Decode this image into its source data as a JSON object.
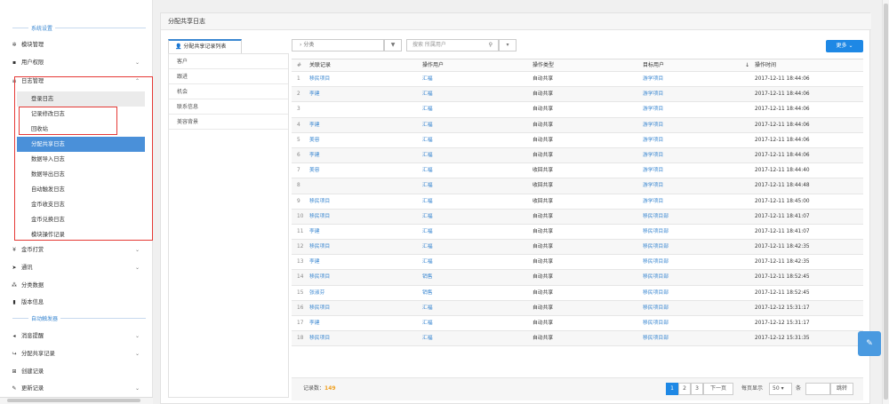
{
  "sidebar": {
    "sections": {
      "system": "系统设置",
      "auto": "自动触发器"
    },
    "items": {
      "module_mgmt": "模块管理",
      "user_perm": "用户权限",
      "log_mgmt": "日志管理",
      "coin_reward": "金币打赏",
      "comm": "通讯",
      "category": "分类数据",
      "version": "版本信息",
      "msg_remind": "消息提醒",
      "share_record": "分配共享记录",
      "create_record": "创建记录",
      "update_record": "更新记录"
    },
    "log_children": [
      "登录日志",
      "记录修改日志",
      "回收站",
      "分配共享日志",
      "数据导入日志",
      "数据导出日志",
      "自动触发日志",
      "金币收支日志",
      "金币兑换日志",
      "模块操作记录"
    ]
  },
  "main": {
    "title": "分配共享日志",
    "left_tab": "分配共享记录列表",
    "left_list": [
      "客户",
      "跟进",
      "机会",
      "联系信息",
      "美容背景"
    ],
    "filter_label": "分类",
    "filter_search_placeholder": "搜索 所属用户",
    "more_button": "更多",
    "columns": [
      "#",
      "关联记录",
      "操作用户",
      "操作类型",
      "目标用户",
      "操作时间"
    ],
    "rows": [
      {
        "n": "1",
        "rec": "移民项目",
        "user": "汇福",
        "type": "自动共享",
        "target": "游学项目",
        "time": "2017-12-11 18:44:06"
      },
      {
        "n": "2",
        "rec": "李建",
        "user": "汇福",
        "type": "自动共享",
        "target": "游学项目",
        "time": "2017-12-11 18:44:06"
      },
      {
        "n": "3",
        "rec": "",
        "user": "汇福",
        "type": "自动共享",
        "target": "游学项目",
        "time": "2017-12-11 18:44:06"
      },
      {
        "n": "4",
        "rec": "李建",
        "user": "汇福",
        "type": "自动共享",
        "target": "游学项目",
        "time": "2017-12-11 18:44:06"
      },
      {
        "n": "5",
        "rec": "美容",
        "user": "汇福",
        "type": "自动共享",
        "target": "游学项目",
        "time": "2017-12-11 18:44:06"
      },
      {
        "n": "6",
        "rec": "李建",
        "user": "汇福",
        "type": "自动共享",
        "target": "游学项目",
        "time": "2017-12-11 18:44:06"
      },
      {
        "n": "7",
        "rec": "美容",
        "user": "汇福",
        "type": "收回共享",
        "target": "游学项目",
        "time": "2017-12-11 18:44:40"
      },
      {
        "n": "8",
        "rec": "",
        "user": "汇福",
        "type": "收回共享",
        "target": "游学项目",
        "time": "2017-12-11 18:44:48"
      },
      {
        "n": "9",
        "rec": "移民项目",
        "user": "汇福",
        "type": "收回共享",
        "target": "游学项目",
        "time": "2017-12-11 18:45:00"
      },
      {
        "n": "10",
        "rec": "移民项目",
        "user": "汇福",
        "type": "自动共享",
        "target": "移民项目部",
        "time": "2017-12-11 18:41:07"
      },
      {
        "n": "11",
        "rec": "李建",
        "user": "汇福",
        "type": "自动共享",
        "target": "移民项目部",
        "time": "2017-12-11 18:41:07"
      },
      {
        "n": "12",
        "rec": "移民项目",
        "user": "汇福",
        "type": "自动共享",
        "target": "移民项目部",
        "time": "2017-12-11 18:42:35"
      },
      {
        "n": "13",
        "rec": "李建",
        "user": "汇福",
        "type": "自动共享",
        "target": "移民项目部",
        "time": "2017-12-11 18:42:35"
      },
      {
        "n": "14",
        "rec": "移民项目",
        "user": "销售",
        "type": "自动共享",
        "target": "移民项目部",
        "time": "2017-12-11 18:52:45"
      },
      {
        "n": "15",
        "rec": "张淑芬",
        "user": "销售",
        "type": "自动共享",
        "target": "移民项目部",
        "time": "2017-12-11 18:52:45"
      },
      {
        "n": "16",
        "rec": "移民项目",
        "user": "汇福",
        "type": "自动共享",
        "target": "移民项目部",
        "time": "2017-12-12 15:31:17"
      },
      {
        "n": "17",
        "rec": "李建",
        "user": "汇福",
        "type": "自动共享",
        "target": "移民项目部",
        "time": "2017-12-12 15:31:17"
      },
      {
        "n": "18",
        "rec": "移民项目",
        "user": "汇福",
        "type": "自动共享",
        "target": "移民项目部",
        "time": "2017-12-12 15:31:35"
      }
    ],
    "footer": {
      "count_label": "记录数：",
      "count": "149",
      "pages": [
        "1",
        "2",
        "3"
      ],
      "next": "下一页",
      "per_page_label": "每页显示",
      "per_page": "50",
      "unit": "条",
      "jump": "跳转"
    }
  },
  "colors": {
    "accent": "#1e88e5",
    "active": "#4a90d9",
    "highlight_box": "#e53935",
    "link": "#3a87d1"
  }
}
